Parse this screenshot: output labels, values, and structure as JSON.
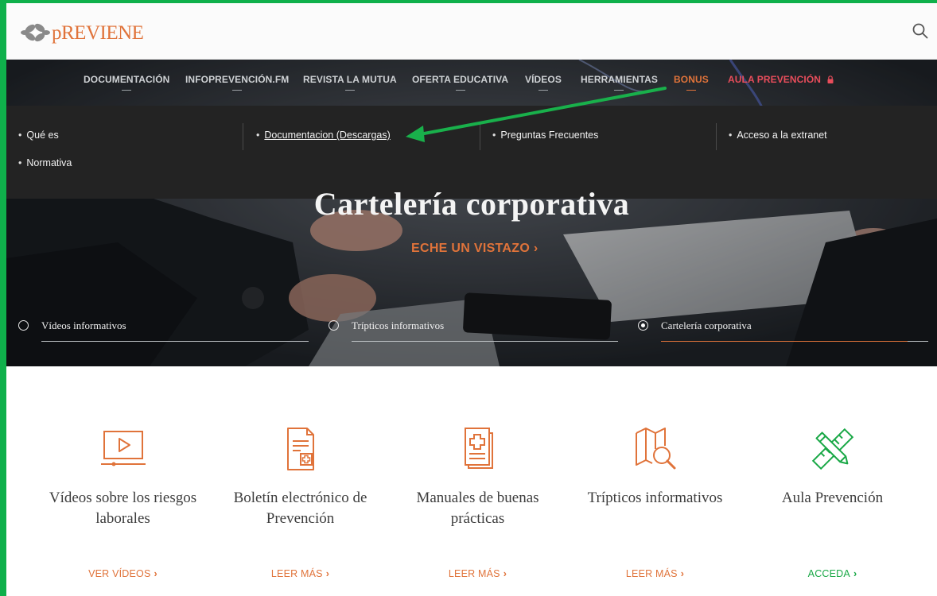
{
  "header": {
    "logo_text": "pREVIENE"
  },
  "nav": {
    "items": [
      {
        "label": "DOCUMENTACIÓN"
      },
      {
        "label": "INFOPREVENCIÓN.FM"
      },
      {
        "label": "REVISTA LA MUTUA"
      },
      {
        "label": "OFERTA EDUCATIVA"
      },
      {
        "label": "VÍDEOS"
      },
      {
        "label": "HERRAMIENTAS"
      },
      {
        "label": "BONUS"
      },
      {
        "label": "AULA PREVENCIÓN"
      }
    ]
  },
  "dropdown": {
    "items": [
      {
        "label": "Qué es"
      },
      {
        "label": "Documentacion (Descargas)"
      },
      {
        "label": "Preguntas Frecuentes"
      },
      {
        "label": "Acceso a la extranet"
      },
      {
        "label": "Normativa"
      }
    ]
  },
  "hero": {
    "title": "Cartelería corporativa",
    "cta": "ECHE UN VISTAZO ›",
    "tabs": [
      {
        "label": "Vídeos informativos",
        "selected": false
      },
      {
        "label": "Trípticos informativos",
        "selected": false
      },
      {
        "label": "Cartelería corporativa",
        "selected": true
      }
    ]
  },
  "features": [
    {
      "title": "Vídeos sobre los riesgos laborales",
      "link": "VER VÍDEOS",
      "icon": "video-player-icon"
    },
    {
      "title": "Boletín electrónico de Prevención",
      "link": "LEER MÁS",
      "icon": "medical-document-icon"
    },
    {
      "title": "Manuales de buenas prácticas",
      "link": "LEER MÁS",
      "icon": "manual-book-icon"
    },
    {
      "title": "Trípticos informativos",
      "link": "LEER MÁS",
      "icon": "map-search-icon"
    },
    {
      "title": "Aula Prevención",
      "link": "ACCEDA",
      "icon": "pencil-ruler-icon"
    }
  ],
  "colors": {
    "accent_orange": "#e0733a",
    "accent_green": "#19a846",
    "aula_red": "#e84d5b",
    "frame_green": "#0fb04b",
    "dropdown_bg": "#232323"
  }
}
